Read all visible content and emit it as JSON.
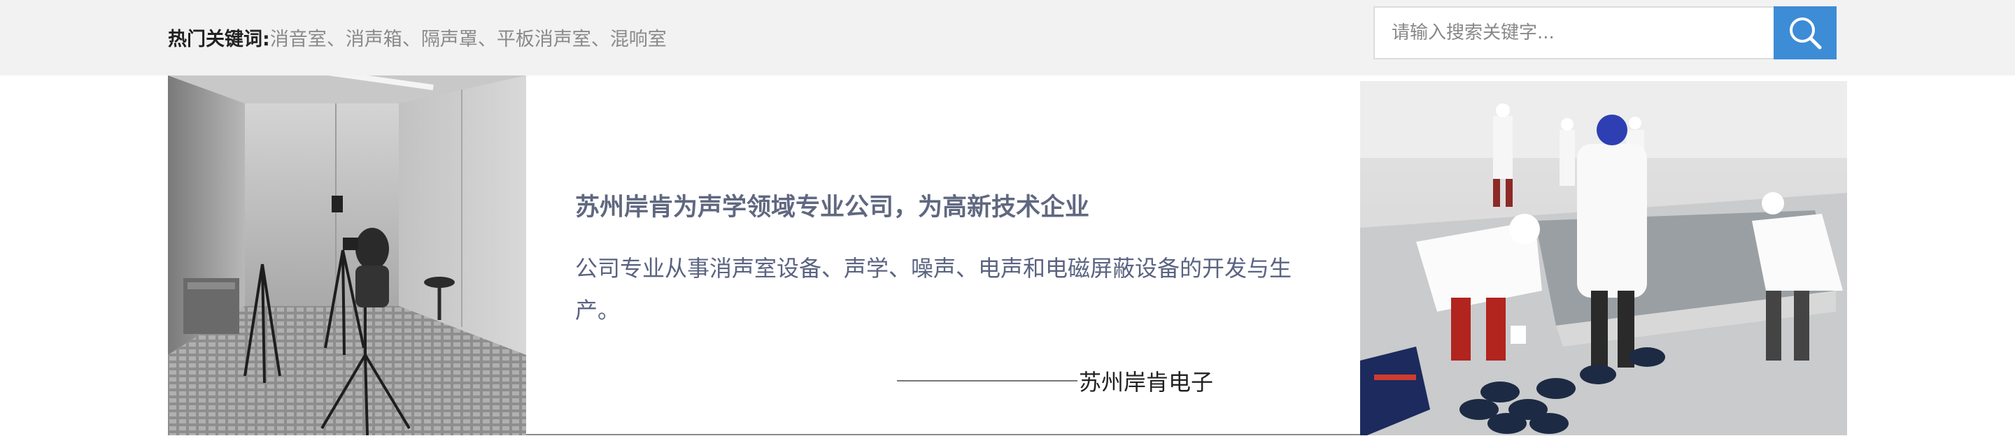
{
  "header": {
    "keywords_label": "热门关键词:",
    "keywords": [
      "消音室",
      "消声箱",
      "隔声罩",
      "平板消声室",
      "混响室"
    ],
    "keyword_separator": "、",
    "search": {
      "placeholder": "请输入搜索关键字...",
      "value": "",
      "button_icon": "search-icon"
    }
  },
  "intro": {
    "headline": "苏州岸肯为声学领域专业公司，为高新技术企业",
    "description": "公司专业从事消声室设备、声学、噪声、电声和电磁屏蔽设备的开发与生产。",
    "signature": "苏州岸肯电子"
  },
  "colors": {
    "accent": "#3d8cd6",
    "topbar_bg": "#f2f2f2",
    "headline": "#606880",
    "keyword": "#8a8a8a"
  }
}
